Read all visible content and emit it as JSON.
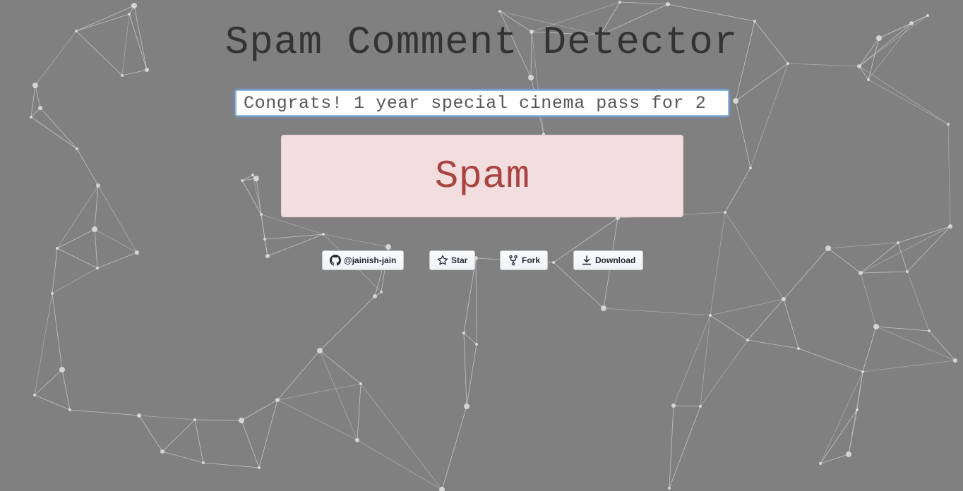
{
  "header": {
    "title": "Spam Comment Detector"
  },
  "comment_input": {
    "value": "Congrats! 1 year special cinema pass for 2"
  },
  "result": {
    "label": "Spam"
  },
  "github_buttons": {
    "follow_label": "@jainish-jain",
    "star_label": "Star",
    "fork_label": "Fork",
    "download_label": "Download"
  },
  "colors": {
    "background": "#808080",
    "title": "#333333",
    "result_background": "#f2dede",
    "result_text": "#a94442"
  }
}
